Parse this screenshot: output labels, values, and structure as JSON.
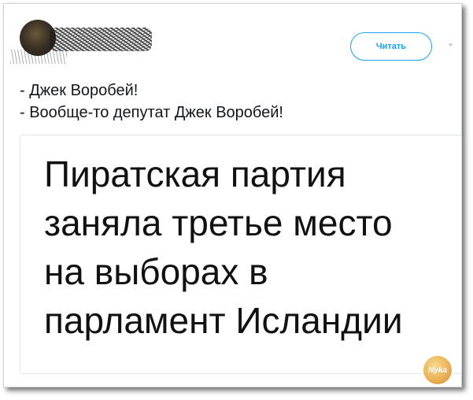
{
  "header": {
    "follow_label": "Читать",
    "caret": "⌄"
  },
  "tweet": {
    "lines": [
      "- Джек Воробей!",
      "- Вообще-то депутат Джек Воробей!"
    ]
  },
  "media": {
    "lines": [
      "Пиратская партия",
      "заняла третье место",
      "на выборах в",
      "парламент Исландии"
    ]
  },
  "watermark": {
    "text": "Nyka"
  },
  "colors": {
    "accent": "#1da1f2",
    "text": "#14171a",
    "border": "#e1e8ed"
  }
}
